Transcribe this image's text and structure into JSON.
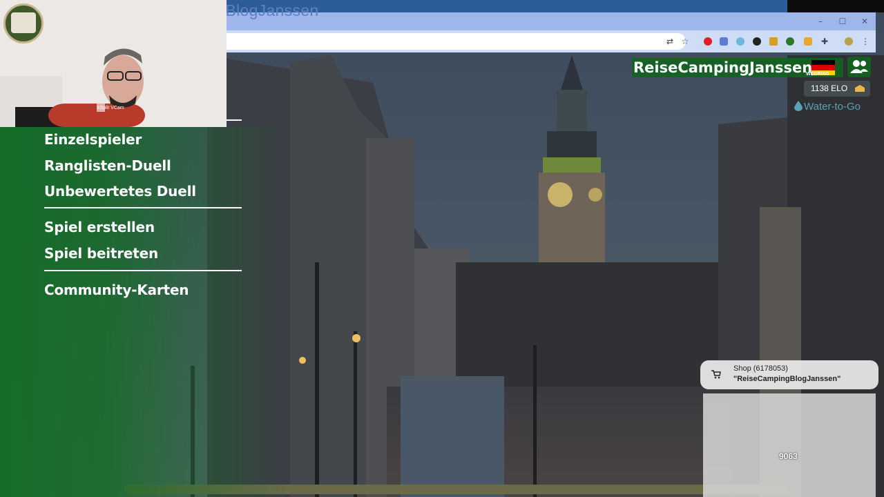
{
  "stream": {
    "title": "ReiseCampingBlogJanssen",
    "cam_label": "XSplit VCam"
  },
  "browser": {
    "window_controls": [
      "–",
      "☐",
      "✕"
    ],
    "toolbar_icons": [
      "translate-icon",
      "star-icon",
      "opera-icon",
      "extension-blue-icon",
      "translate-ext-icon",
      "circle-ext-icon",
      "pen-ext-icon",
      "green-ext-icon",
      "orange-ext-icon",
      "puzzle-icon",
      "profile-icon",
      "menu-icon"
    ]
  },
  "menu": {
    "group1": [
      "Einzelspieler",
      "Ranglisten-Duell",
      "Unbewertetes Duell"
    ],
    "group2": [
      "Spiel erstellen",
      "Spiel beitreten"
    ],
    "group3": [
      "Community-Karten"
    ]
  },
  "profile": {
    "name": "ReiseCampingJanssen",
    "badge": "WEDRING",
    "elo": "1138 ELO",
    "sponsor": "Water-to-Go",
    "flag_colors": [
      "#000000",
      "#dd0000",
      "#ffce00"
    ]
  },
  "shop": {
    "line1": "Shop (6178053)",
    "line2": "\"ReiseCampingBlogJanssen\""
  },
  "counter": "9063"
}
